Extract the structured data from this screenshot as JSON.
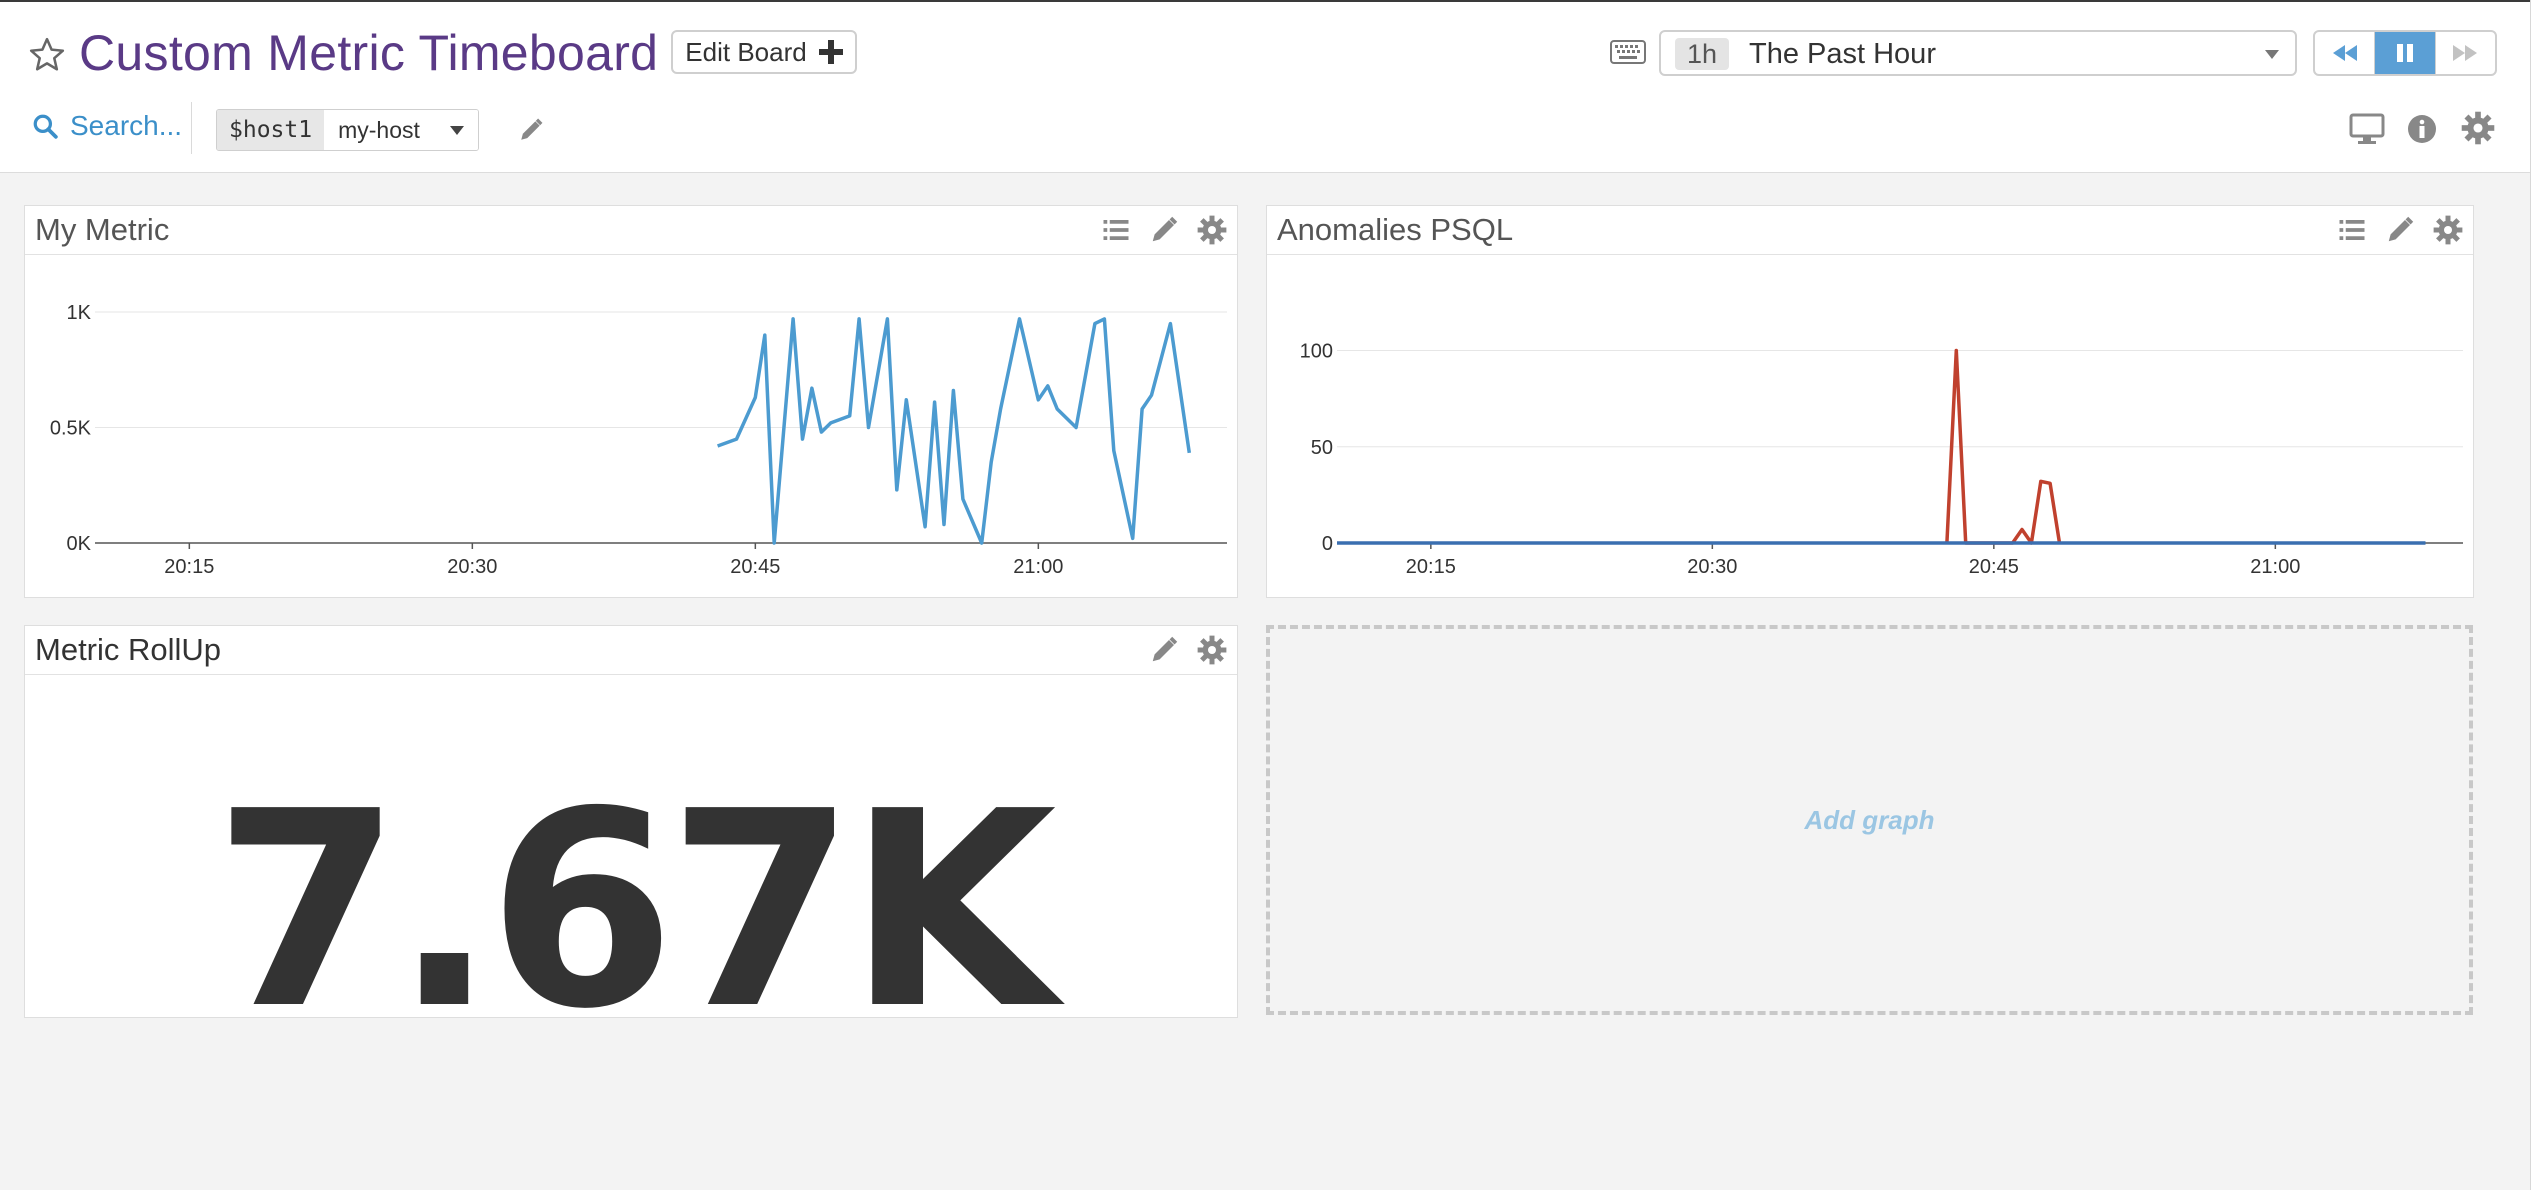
{
  "header": {
    "title": "Custom Metric Timeboard",
    "edit_board_label": "Edit Board",
    "search_label": "Search...",
    "template_variable": {
      "name": "$host1",
      "value": "my-host"
    },
    "time": {
      "badge": "1h",
      "label": "The Past Hour"
    }
  },
  "icons": {
    "star": "star-icon",
    "plus": "plus-icon",
    "keyboard": "keyboard-icon",
    "rewind": "rewind-icon",
    "pause": "pause-icon",
    "forward": "fast-forward-icon",
    "search": "search-icon",
    "pencil": "pencil-icon",
    "tv": "tv-mode-icon",
    "info": "info-icon",
    "gear": "gear-icon",
    "list": "list-icon"
  },
  "colors": {
    "title": "#5a3a86",
    "link": "#3b8fc9",
    "active_button": "#5b9fd5",
    "series_blue": "#4c9bd0",
    "series_red": "#c0412e",
    "add_graph": "#9bc6e3"
  },
  "widgets": {
    "my_metric": {
      "title": "My Metric"
    },
    "anomalies": {
      "title": "Anomalies PSQL"
    },
    "rollup": {
      "title": "Metric RollUp",
      "value": "7.67K"
    },
    "add_graph_label": "Add graph"
  },
  "chart_data": [
    {
      "type": "line",
      "title": "My Metric",
      "x_ticks": [
        "20:15",
        "20:30",
        "20:45",
        "21:00"
      ],
      "y_ticks": [
        "0K",
        "0.5K",
        "1K"
      ],
      "xlim": [
        "20:10",
        "21:10"
      ],
      "ylim": [
        0,
        1000
      ],
      "grid": true,
      "series": [
        {
          "color": "#4c9bd0",
          "x": [
            "20:43",
            "20:44",
            "20:45",
            "20:45:30",
            "20:46",
            "20:47",
            "20:47:30",
            "20:48",
            "20:48:30",
            "20:49",
            "20:50",
            "20:50:30",
            "20:51",
            "20:52",
            "20:52:30",
            "20:53",
            "20:54",
            "20:54:30",
            "20:55",
            "20:55:30",
            "20:56",
            "20:57",
            "20:57:30",
            "20:58",
            "20:59",
            "21:00",
            "21:00:30",
            "21:01",
            "21:02",
            "21:03",
            "21:03:30",
            "21:04",
            "21:05",
            "21:05:30",
            "21:06",
            "21:07",
            "21:08"
          ],
          "y": [
            420,
            450,
            630,
            900,
            0,
            970,
            450,
            670,
            480,
            520,
            550,
            970,
            500,
            970,
            230,
            620,
            70,
            610,
            80,
            660,
            190,
            0,
            350,
            580,
            970,
            620,
            680,
            580,
            500,
            950,
            970,
            400,
            20,
            580,
            640,
            950,
            390
          ]
        }
      ]
    },
    {
      "type": "line",
      "title": "Anomalies PSQL",
      "x_ticks": [
        "20:15",
        "20:30",
        "20:45",
        "21:00"
      ],
      "y_ticks": [
        "0",
        "50",
        "100"
      ],
      "xlim": [
        "20:10",
        "21:10"
      ],
      "ylim": [
        0,
        120
      ],
      "grid": true,
      "series": [
        {
          "color": "#c0412e",
          "x": [
            "20:42:30",
            "20:43",
            "20:43:30",
            "20:44",
            "20:45",
            "20:46",
            "20:46:30",
            "20:47",
            "20:47:30",
            "20:48",
            "20:48:30"
          ],
          "y": [
            0,
            100,
            0,
            0,
            0,
            0,
            7,
            0,
            32,
            31,
            0
          ]
        },
        {
          "color": "#3a6fb0",
          "x": [
            "20:10",
            "21:08"
          ],
          "y": [
            0,
            0
          ]
        }
      ]
    }
  ]
}
